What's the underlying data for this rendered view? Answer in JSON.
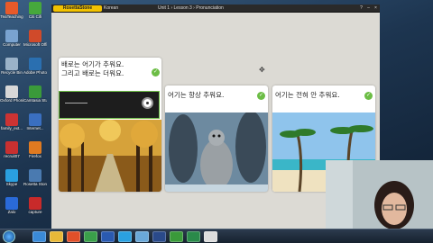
{
  "desktop": {
    "icons": [
      {
        "label": "TeaTeaching",
        "color": "#e85a2a"
      },
      {
        "label": "Citi Cifi",
        "color": "#46a83c"
      },
      {
        "label": "Computer",
        "color": "#7aa3d0"
      },
      {
        "label": "Microsoft Office Pe...",
        "color": "#d04a2a"
      },
      {
        "label": "Recycle Bin",
        "color": "#9ab2c8"
      },
      {
        "label": "Adobe Photosh...",
        "color": "#2a6fb0"
      },
      {
        "label": "Oxford Phonics W...",
        "color": "#d8d8d8"
      },
      {
        "label": "Camtasia Studio 8",
        "color": "#3a9a3a"
      },
      {
        "label": "family_ext...",
        "color": "#cc3333"
      },
      {
        "label": "Internet...",
        "color": "#3a6fc0"
      },
      {
        "label": "recruit07",
        "color": "#c83030"
      },
      {
        "label": "Firefox",
        "color": "#e07a20"
      },
      {
        "label": "Skype",
        "color": "#2aa0e0"
      },
      {
        "label": "Rosetta Stone",
        "color": "#4a7ab0"
      },
      {
        "label": "Zalo",
        "color": "#2a6ad8"
      },
      {
        "label": "capture",
        "color": "#c82a2a"
      }
    ]
  },
  "app": {
    "logo": "RosettaStone",
    "course": "Korean",
    "breadcrumb": "Unit 1 › Lesson 3 › Pronunciation",
    "buttons": {
      "help": "?",
      "minimize": "–",
      "close": "×"
    }
  },
  "cards": [
    {
      "text": "배로는 어기가 추워요.\n그리고 배로는 더워요.",
      "check": "✓"
    },
    {
      "text": "어기는 항상 추워요.",
      "check": "✓"
    },
    {
      "text": "어기는 전혀 안 추워요.",
      "check": "✓"
    }
  ],
  "recorder": {
    "level": 0.22
  },
  "taskbar": {
    "items": [
      {
        "name": "ie",
        "color": "#3a8ad8"
      },
      {
        "name": "explorer",
        "color": "#e8b838"
      },
      {
        "name": "media",
        "color": "#e0502a"
      },
      {
        "name": "chrome",
        "color": "#3aa04a"
      },
      {
        "name": "word",
        "color": "#2a5ab0"
      },
      {
        "name": "skype",
        "color": "#2aa0e0"
      },
      {
        "name": "rosetta",
        "color": "#6aa8d8"
      },
      {
        "name": "photoshop",
        "color": "#2a4a8a"
      },
      {
        "name": "camtasia",
        "color": "#3a9a3a"
      },
      {
        "name": "excel",
        "color": "#2a8a4a"
      },
      {
        "name": "capture",
        "color": "#dddddd"
      }
    ]
  }
}
